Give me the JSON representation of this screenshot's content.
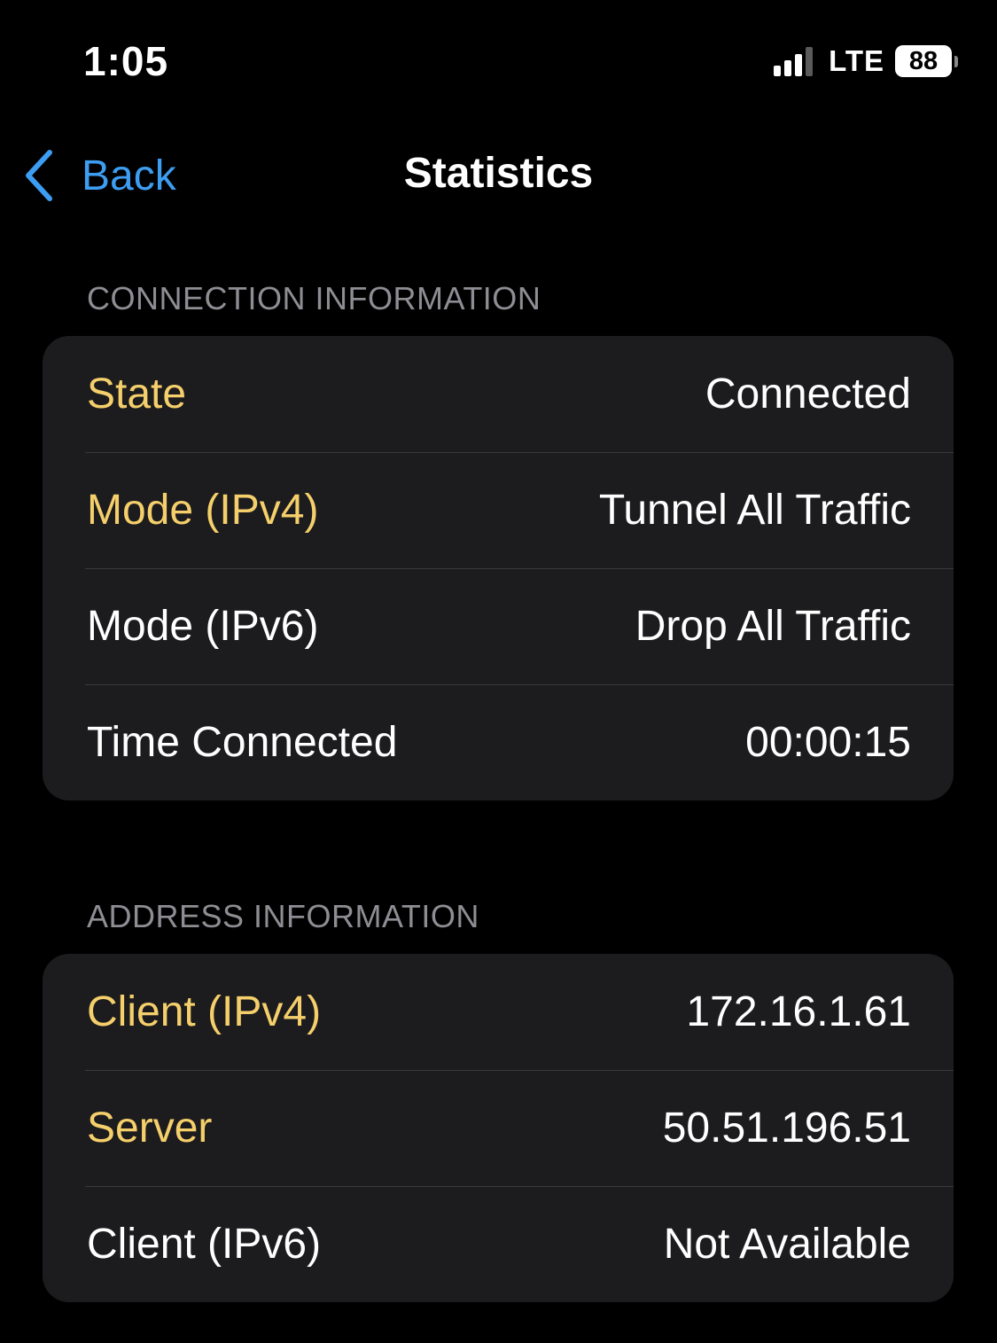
{
  "status_bar": {
    "time": "1:05",
    "network": "LTE",
    "battery": "88"
  },
  "nav": {
    "back_label": "Back",
    "title": "Statistics"
  },
  "connection": {
    "header": "CONNECTION INFORMATION",
    "rows": [
      {
        "label": "State",
        "value": "Connected"
      },
      {
        "label": "Mode (IPv4)",
        "value": "Tunnel All Traffic"
      },
      {
        "label": "Mode (IPv6)",
        "value": "Drop All Traffic"
      },
      {
        "label": "Time Connected",
        "value": "00:00:15"
      }
    ]
  },
  "address": {
    "header": "ADDRESS INFORMATION",
    "rows": [
      {
        "label": "Client (IPv4)",
        "value": "172.16.1.61"
      },
      {
        "label": "Server",
        "value": "50.51.196.51"
      },
      {
        "label": "Client (IPv6)",
        "value": "Not Available"
      }
    ]
  },
  "colors": {
    "background": "#000000",
    "group_background": "#1c1c1e",
    "accent": "#3d9df2",
    "highlight_text": "#f5cf6b",
    "section_header": "#8d8d93"
  }
}
